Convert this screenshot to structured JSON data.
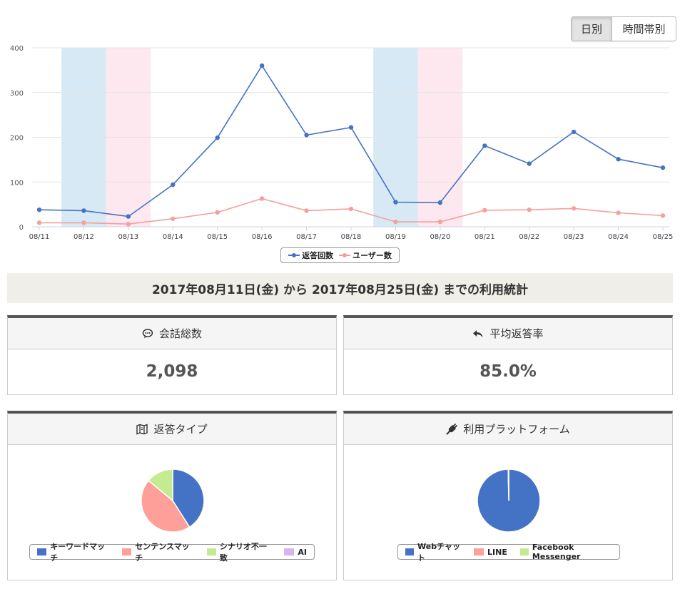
{
  "view_toggle": {
    "daily": "日別",
    "hourly": "時間帯別"
  },
  "chart_data": [
    {
      "type": "line",
      "x": [
        "08/11",
        "08/12",
        "08/13",
        "08/14",
        "08/15",
        "08/16",
        "08/17",
        "08/18",
        "08/19",
        "08/20",
        "08/21",
        "08/22",
        "08/23",
        "08/24",
        "08/25"
      ],
      "series": [
        {
          "name": "返答回数",
          "color": "#4472c4",
          "values": [
            38,
            36,
            23,
            94,
            199,
            360,
            205,
            222,
            55,
            54,
            181,
            141,
            212,
            151,
            132
          ]
        },
        {
          "name": "ユーザー数",
          "color": "#f4a09c",
          "values": [
            9,
            9,
            6,
            18,
            32,
            63,
            36,
            40,
            11,
            11,
            37,
            38,
            41,
            31,
            25
          ]
        }
      ],
      "ylim": [
        0,
        400
      ],
      "yticks": [
        0,
        100,
        200,
        300,
        400
      ],
      "highlight_bands": [
        {
          "category": "08/12",
          "color": "#d6e9f5"
        },
        {
          "category": "08/13",
          "color": "#fde8f0"
        },
        {
          "category": "08/19",
          "color": "#d6e9f5"
        },
        {
          "category": "08/20",
          "color": "#fde8f0"
        }
      ],
      "grid": true,
      "legend": "bottom-center"
    },
    {
      "type": "pie",
      "title": "返答タイプ",
      "slices": [
        {
          "label": "キーワードマッチ",
          "value": 41,
          "color": "#4472c4"
        },
        {
          "label": "センテンスマッチ",
          "value": 45,
          "color": "#ff9f9a"
        },
        {
          "label": "シナリオ不一致",
          "value": 14,
          "color": "#c3eb90"
        },
        {
          "label": "AI",
          "value": 0,
          "color": "#d5b4f0"
        }
      ],
      "legend": "bottom-center"
    },
    {
      "type": "pie",
      "title": "利用プラットフォーム",
      "slices": [
        {
          "label": "Webチャット",
          "value": 99.7,
          "color": "#4472c4"
        },
        {
          "label": "LINE",
          "value": 0.3,
          "color": "#ff9f9a"
        },
        {
          "label": "Facebook Messenger",
          "value": 0,
          "color": "#c3eb90"
        }
      ],
      "legend": "bottom-center"
    }
  ],
  "banner": "2017年08月11日(金) から 2017年08月25日(金) までの利用統計",
  "stats": {
    "total_conversations": {
      "label": "会話総数",
      "value": "2,098"
    },
    "avg_response_rate": {
      "label": "平均返答率",
      "value": "85.0%"
    }
  },
  "icons": {
    "conversation": "speech-bubble-icon",
    "response_rate": "reply-arrow-icon",
    "response_type": "map-book-icon",
    "platform": "plug-icon"
  }
}
